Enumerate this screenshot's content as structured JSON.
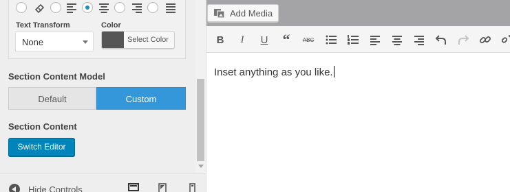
{
  "typography": {
    "text_transform_label": "Text Transform",
    "text_transform_value": "None",
    "color_label": "Color",
    "color_button_label": "Select Color",
    "color_value": "#555555",
    "alignment_selected": "left"
  },
  "section_content_model": {
    "heading": "Section Content Model",
    "options": [
      "Default",
      "Custom"
    ],
    "selected": "Custom"
  },
  "section_content": {
    "heading": "Section Content",
    "switch_editor_label": "Switch Editor"
  },
  "footer": {
    "hide_controls_label": "Hide Controls"
  },
  "editor": {
    "add_media_label": "Add Media",
    "content": "Inset anything as you like.",
    "toolbar": [
      "bold",
      "italic",
      "underline",
      "blockquote",
      "strikethrough",
      "bulleted-list",
      "numbered-list",
      "align-left",
      "align-center",
      "align-right",
      "undo",
      "redo",
      "insert-link",
      "remove-link"
    ]
  },
  "colors": {
    "accent": "#3497da",
    "primary_button": "#0085ba",
    "media_bar": "#a4a4a6"
  }
}
